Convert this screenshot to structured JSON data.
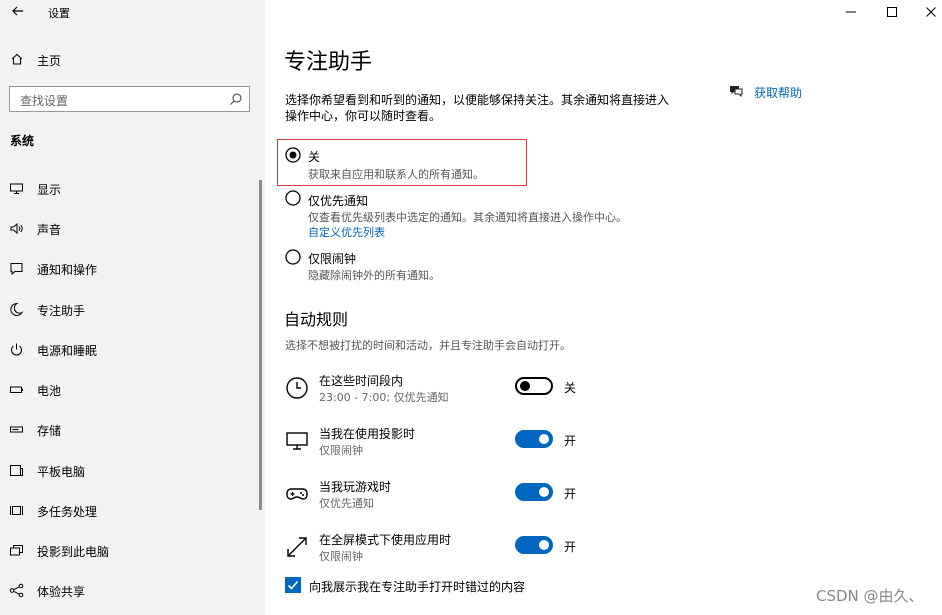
{
  "window": {
    "title": "设置"
  },
  "sidebar": {
    "home_label": "主页",
    "search_placeholder": "查找设置",
    "group_title": "系统",
    "items": [
      {
        "label": "显示",
        "icon": "monitor-icon"
      },
      {
        "label": "声音",
        "icon": "speaker-icon"
      },
      {
        "label": "通知和操作",
        "icon": "notification-icon"
      },
      {
        "label": "专注助手",
        "icon": "moon-icon"
      },
      {
        "label": "电源和睡眠",
        "icon": "power-icon"
      },
      {
        "label": "电池",
        "icon": "battery-icon"
      },
      {
        "label": "存储",
        "icon": "storage-icon"
      },
      {
        "label": "平板电脑",
        "icon": "tablet-icon"
      },
      {
        "label": "多任务处理",
        "icon": "multitask-icon"
      },
      {
        "label": "投影到此电脑",
        "icon": "project-icon"
      },
      {
        "label": "体验共享",
        "icon": "share-icon"
      }
    ]
  },
  "main": {
    "title": "专注助手",
    "description": "选择你希望看到和听到的通知，以便能够保持关注。其余通知将直接进入操作中心，你可以随时查看。",
    "help_label": "获取帮助",
    "options": [
      {
        "label": "关",
        "desc": "获取来自应用和联系人的所有通知。",
        "selected": true
      },
      {
        "label": "仅优先通知",
        "desc": "仅查看优先级列表中选定的通知。其余通知将直接进入操作中心。",
        "link": "自定义优先列表",
        "selected": false
      },
      {
        "label": "仅限闹钟",
        "desc": "隐藏除闹钟外的所有通知。",
        "selected": false
      }
    ],
    "auto_rules": {
      "title": "自动规则",
      "subtitle": "选择不想被打扰的时间和活动，并且专注助手会自动打开。",
      "rules": [
        {
          "title": "在这些时间段内",
          "detail": "23:00 - 7:00; 仅优先通知",
          "state": "关",
          "on": false,
          "icon": "clock-icon"
        },
        {
          "title": "当我在使用投影时",
          "detail": "仅限闹钟",
          "state": "开",
          "on": true,
          "icon": "display-icon"
        },
        {
          "title": "当我玩游戏时",
          "detail": "仅优先通知",
          "state": "开",
          "on": true,
          "icon": "gamepad-icon"
        },
        {
          "title": "在全屏模式下使用应用时",
          "detail": "仅限闹钟",
          "state": "开",
          "on": true,
          "icon": "fullscreen-icon"
        }
      ]
    },
    "checkbox": {
      "label": "向我展示我在专注助手打开时错过的内容",
      "checked": true
    }
  },
  "watermark": "CSDN @由久、",
  "colors": {
    "accent": "#0067c0",
    "link": "#0067b8",
    "highlight_border": "#d83b3b",
    "sidebar_bg": "#f2f2f2"
  }
}
